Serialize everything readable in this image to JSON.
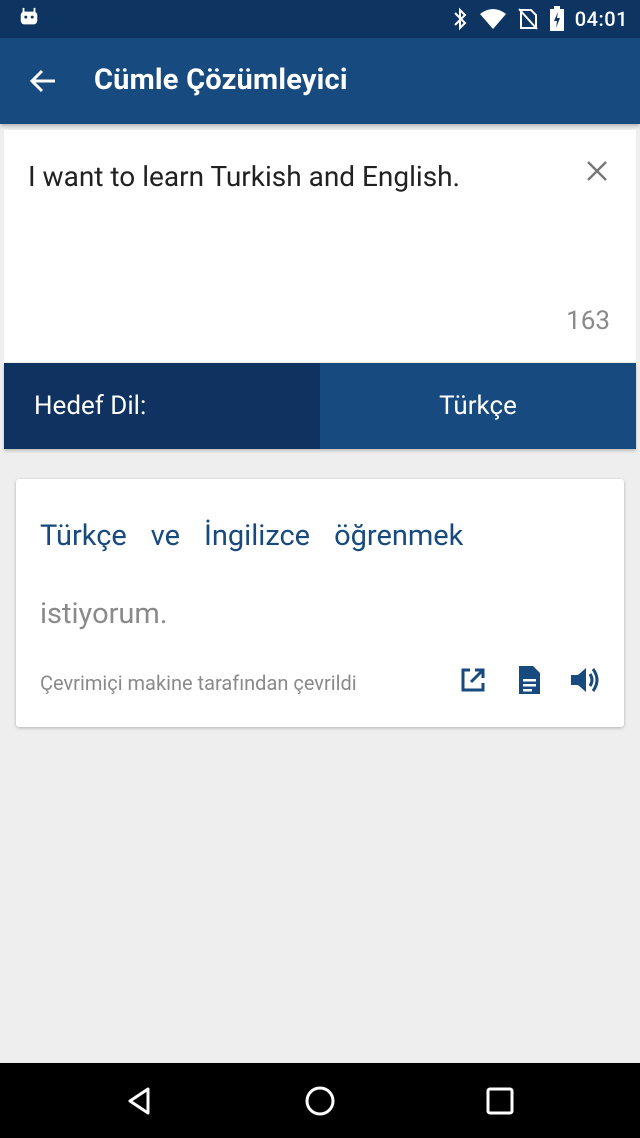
{
  "status_bar": {
    "time": "04:01",
    "icons": [
      "android-icon",
      "bluetooth-icon",
      "wifi-icon",
      "no-sim-icon",
      "battery-charging-icon"
    ]
  },
  "app_bar": {
    "title": "Cümle Çözümleyici",
    "back_icon": "arrow-back-icon"
  },
  "input": {
    "text": "I want to learn Turkish and English.",
    "char_count": "163",
    "clear_icon": "close-icon"
  },
  "target_language": {
    "label": "Hedef Dil:",
    "value": "Türkçe"
  },
  "result": {
    "lines": [
      [
        "Türkçe",
        "ve",
        "İngilizce",
        "öğrenmek"
      ],
      [
        "istiyorum."
      ]
    ],
    "note": "Çevrimiçi makine tarafından çevrildi",
    "actions": [
      "open-external-icon",
      "document-icon",
      "volume-icon"
    ]
  },
  "nav_bar": {
    "buttons": [
      "back-triangle-icon",
      "home-circle-icon",
      "recents-square-icon"
    ]
  },
  "colors": {
    "status_bar": "#0e3561",
    "app_bar": "#174a7e",
    "label_cell": "#103261",
    "accent_text": "#174a7e",
    "background": "#eeeeee"
  }
}
